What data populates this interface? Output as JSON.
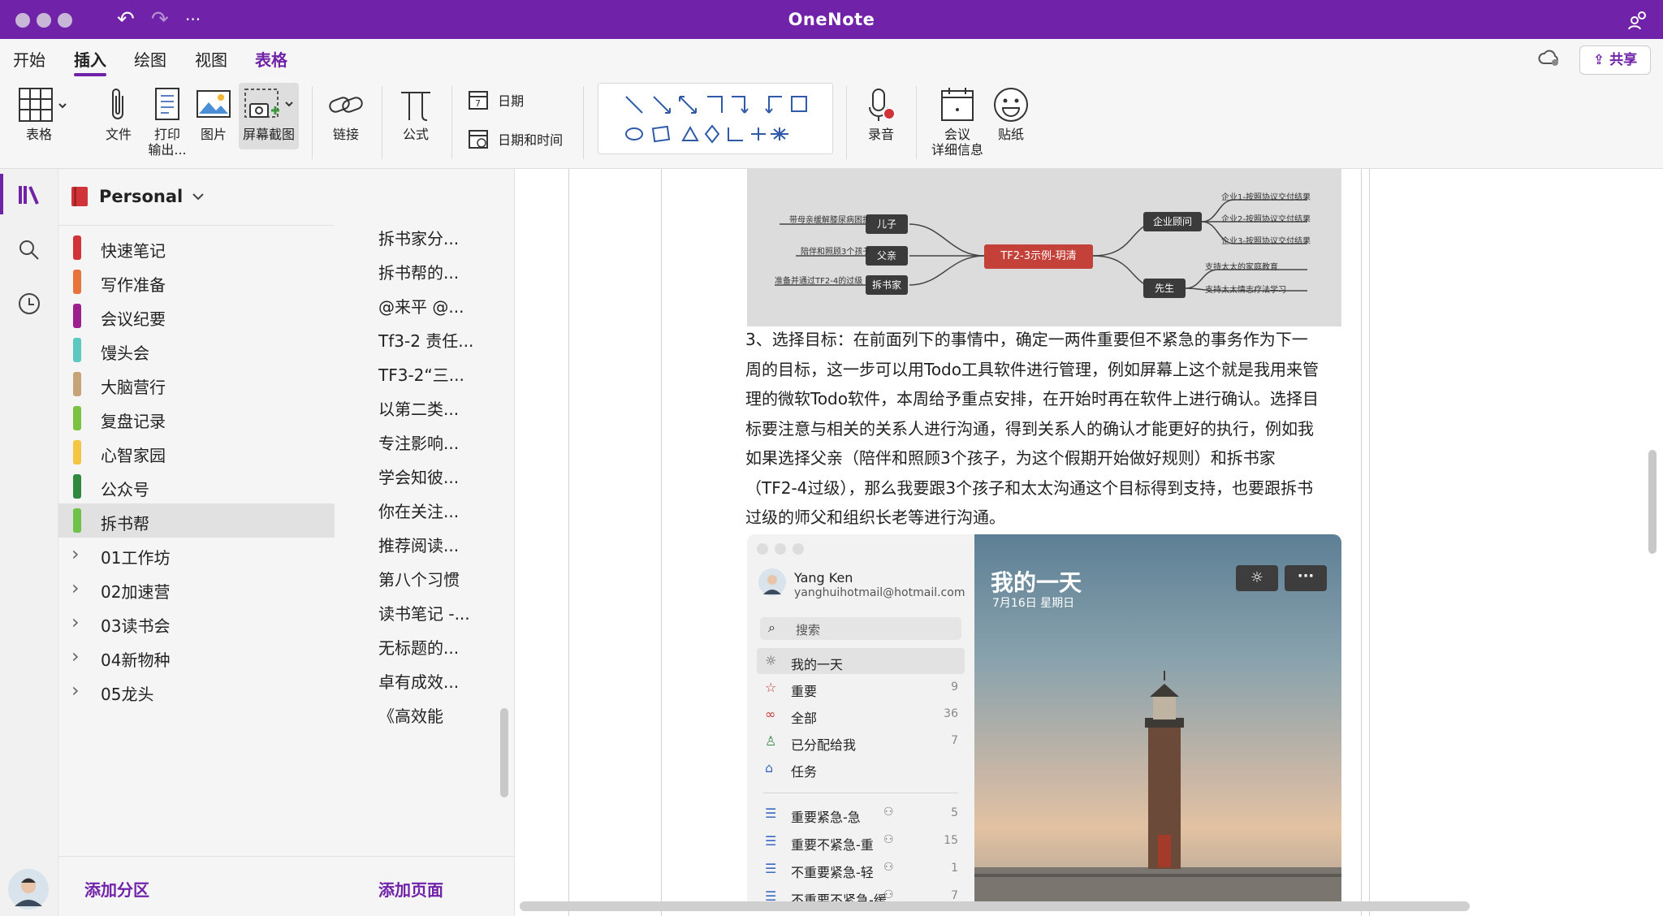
{
  "window": {
    "title": "OneNote"
  },
  "titlebar": {
    "undo_icon": "↶",
    "redo_icon": "↷",
    "more_icon": "···"
  },
  "tabs": [
    {
      "label": "开始"
    },
    {
      "label": "插入"
    },
    {
      "label": "绘图"
    },
    {
      "label": "视图"
    },
    {
      "label": "表格"
    }
  ],
  "share_label": "共享",
  "ribbon": {
    "table": "表格",
    "file": "文件",
    "print": "打印",
    "print2": "输出...",
    "picture": "图片",
    "screenshot": "屏幕截图",
    "link": "链接",
    "equation": "公式",
    "date": "日期",
    "datetime": "日期和时间",
    "audio": "录音",
    "meeting": "会议",
    "meeting2": "详细信息",
    "sticker": "贴纸"
  },
  "notebook": {
    "name": "Personal"
  },
  "sections": [
    {
      "label": "快速笔记",
      "color": "#d13438"
    },
    {
      "label": "写作准备",
      "color": "#e8743b"
    },
    {
      "label": "会议纪要",
      "color": "#9b1f8f"
    },
    {
      "label": "馒头会",
      "color": "#5cc8c0"
    },
    {
      "label": "大脑营行",
      "color": "#c7a477"
    },
    {
      "label": "复盘记录",
      "color": "#7cc242"
    },
    {
      "label": "心智家园",
      "color": "#f4c542"
    },
    {
      "label": "公众号",
      "color": "#2f8a3e"
    },
    {
      "label": "拆书帮",
      "color": "#6cc24a"
    }
  ],
  "section_groups": [
    {
      "label": "01工作坊"
    },
    {
      "label": "02加速营"
    },
    {
      "label": "03读书会"
    },
    {
      "label": "04新物种"
    },
    {
      "label": "05龙头"
    }
  ],
  "pages": [
    {
      "label": "拆书家分..."
    },
    {
      "label": "拆书帮的..."
    },
    {
      "label": "@来平 @..."
    },
    {
      "label": "Tf3-2 责任..."
    },
    {
      "label": "TF3-2“三..."
    },
    {
      "label": "以第二类..."
    },
    {
      "label": "专注影响..."
    },
    {
      "label": "学会知彼..."
    },
    {
      "label": "你在关注..."
    },
    {
      "label": "推荐阅读..."
    },
    {
      "label": "第八个习惯"
    },
    {
      "label": "读书笔记 -..."
    },
    {
      "label": "无标题的..."
    },
    {
      "label": "卓有成效..."
    },
    {
      "label": "《高效能"
    }
  ],
  "footer": {
    "add_section": "添加分区",
    "add_page": "添加页面"
  },
  "mindmap": {
    "center": "TF2-3示例-玥清",
    "left_nodes": [
      "儿子",
      "父亲",
      "拆书家"
    ],
    "left_leaves": [
      "带母亲缓解膝尿病困扰",
      "陪伴和照顾3个孩子",
      "准备并通过TF2-4的过级"
    ],
    "right_nodes": [
      "企业顾问",
      "先生"
    ],
    "right_leaves": [
      "企业1-按照协议交付结果",
      "企业2-按照协议交付结果",
      "企业3-按照协议交付结果",
      "支持太太的家庭教育",
      "支持太太情志疗法学习"
    ]
  },
  "note_paragraph": [
    "3、选择目标：在前面列下的事情中，确定一两件重要但不紧急的事务作为下一",
    "周的目标，这一步可以用Todo工具软件进行管理，例如屏幕上这个就是我用来管",
    "理的微软Todo软件，本周给予重点安排，在开始时再在软件上进行确认。选择目",
    "标要注意与相关的关系人进行沟通，得到关系人的确认才能更好的执行，例如我",
    "如果选择父亲（陪伴和照顾3个孩子，为这个假期开始做好规则）和拆书家",
    "（TF2-4过级），那么我要跟3个孩子和太太沟通这个目标得到支持，也要跟拆书",
    "过级的师父和组织长老等进行沟通。"
  ],
  "todo": {
    "user_name": "Yang Ken",
    "user_email": "yanghuihotmail@hotmail.com",
    "search_placeholder": "搜索",
    "hero_title": "我的一天",
    "hero_date": "7月16日 星期日",
    "lists": [
      {
        "label": "我的一天",
        "count": "",
        "icon": "☼"
      },
      {
        "label": "重要",
        "count": "9",
        "icon": "☆"
      },
      {
        "label": "全部",
        "count": "36",
        "icon": "∞"
      },
      {
        "label": "已分配给我",
        "count": "7",
        "icon": "♙"
      },
      {
        "label": "任务",
        "count": "",
        "icon": "⌂"
      }
    ],
    "custom_lists": [
      {
        "label": "重要紧急-急",
        "count": "5"
      },
      {
        "label": "重要不紧急-重",
        "count": "15"
      },
      {
        "label": "不重要紧急-轻",
        "count": "1"
      },
      {
        "label": "不重要不紧急-缓",
        "count": "7"
      }
    ]
  },
  "colors": {
    "accent": "#7022a8"
  }
}
